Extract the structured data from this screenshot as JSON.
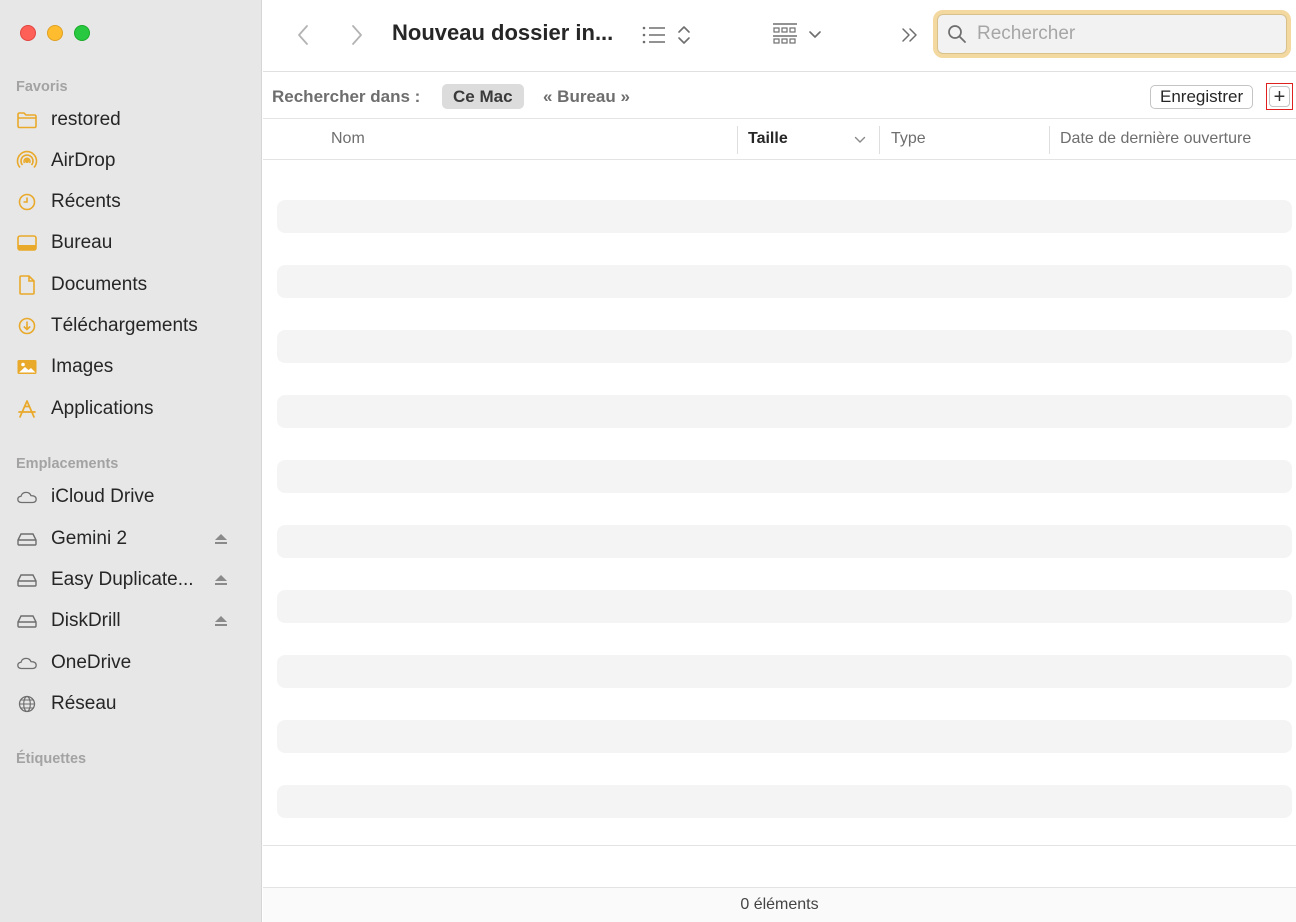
{
  "window": {
    "title": "Nouveau dossier in..."
  },
  "sidebar": {
    "sections": [
      {
        "label": "Favoris"
      },
      {
        "label": "Emplacements"
      },
      {
        "label": "Étiquettes"
      }
    ],
    "favorites": [
      {
        "label": "restored",
        "icon": "folder-icon"
      },
      {
        "label": "AirDrop",
        "icon": "airdrop-icon"
      },
      {
        "label": "Récents",
        "icon": "clock-icon"
      },
      {
        "label": "Bureau",
        "icon": "desktop-icon"
      },
      {
        "label": "Documents",
        "icon": "document-icon"
      },
      {
        "label": "Téléchargements",
        "icon": "download-icon"
      },
      {
        "label": "Images",
        "icon": "photo-icon"
      },
      {
        "label": "Applications",
        "icon": "applications-icon"
      }
    ],
    "locations": [
      {
        "label": "iCloud Drive",
        "icon": "cloud-icon"
      },
      {
        "label": "Gemini 2",
        "icon": "drive-icon"
      },
      {
        "label": "Easy Duplicate...",
        "icon": "drive-icon"
      },
      {
        "label": "DiskDrill",
        "icon": "drive-icon"
      },
      {
        "label": "OneDrive",
        "icon": "cloud-icon"
      },
      {
        "label": "Réseau",
        "icon": "network-icon"
      }
    ]
  },
  "search": {
    "placeholder": "Rechercher",
    "value": ""
  },
  "scope": {
    "label": "Rechercher dans :",
    "selected": "Ce Mac",
    "alternate": "« Bureau »",
    "save_label": "Enregistrer",
    "add_label": "+"
  },
  "columns": {
    "name": "Nom",
    "size": "Taille",
    "type": "Type",
    "last_opened": "Date de dernière ouverture"
  },
  "status": {
    "count": "0 éléments"
  },
  "colors": {
    "accent_red": "#e0201e",
    "icon_yellow": "#e9a92a",
    "search_focus": "#f3d9a0"
  }
}
